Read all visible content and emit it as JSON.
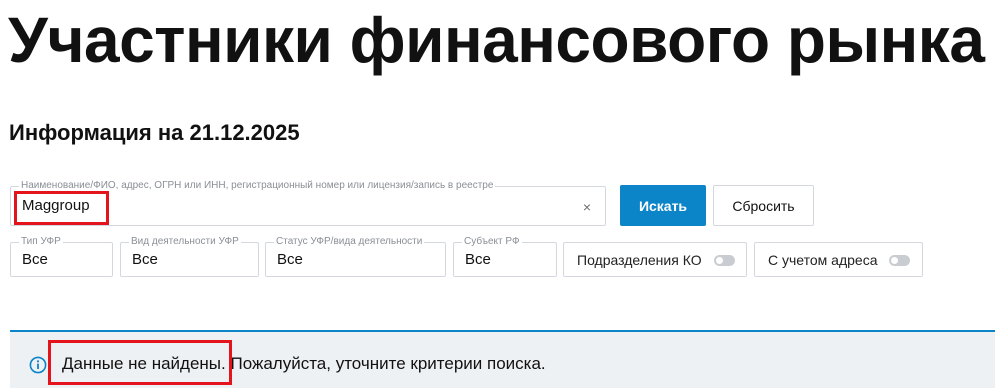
{
  "page": {
    "title": "Участники финансового рынка",
    "info_date": "Информация на 21.12.2025"
  },
  "search": {
    "label": "Наименование/ФИО, адрес, ОГРН или ИНН, регистрационный номер или лицензия/запись в реестре",
    "value": "Maggroup",
    "clear_icon": "×",
    "search_button": "Искать",
    "reset_button": "Сбросить"
  },
  "filters": [
    {
      "label": "Тип УФР",
      "value": "Все"
    },
    {
      "label": "Вид деятельности УФР",
      "value": "Все"
    },
    {
      "label": "Статус УФР/вида деятельности",
      "value": "Все"
    },
    {
      "label": "Субъект РФ",
      "value": "Все"
    }
  ],
  "toggles": [
    {
      "label": "Подразделения КО",
      "on": false
    },
    {
      "label": "С учетом адреса",
      "on": false
    }
  ],
  "alert": {
    "text_part1": "Данные не найдены.",
    "text_part2": " Пожалуйста, уточните критерии поиска.",
    "icon": "info-icon"
  },
  "colors": {
    "accent": "#0b84c8",
    "highlight": "#e3141b",
    "alert_bg": "#eef1f4"
  }
}
